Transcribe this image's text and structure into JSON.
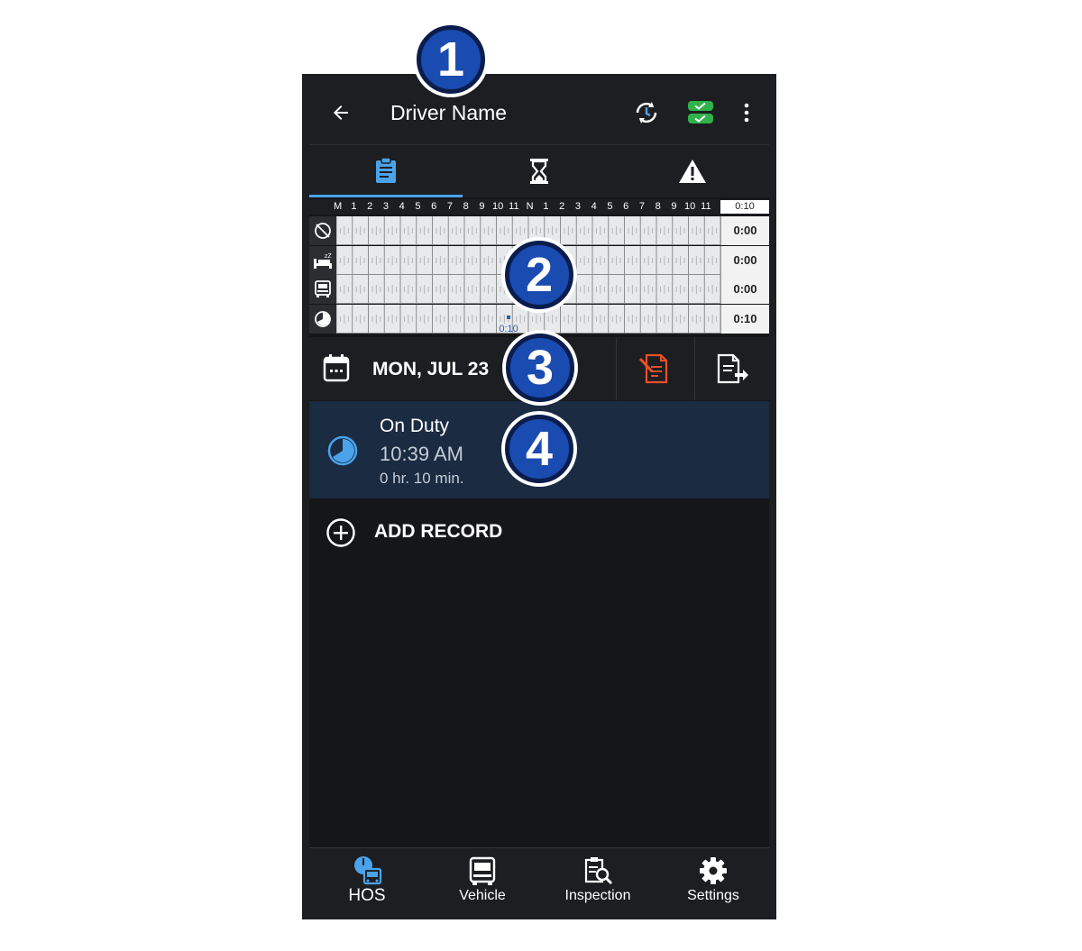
{
  "header": {
    "title": "Driver Name"
  },
  "grid": {
    "hours": [
      "M",
      "1",
      "2",
      "3",
      "4",
      "5",
      "6",
      "7",
      "8",
      "9",
      "10",
      "11",
      "N",
      "1",
      "2",
      "3",
      "4",
      "5",
      "6",
      "7",
      "8",
      "9",
      "10",
      "11"
    ],
    "total_header": "0:10",
    "rows": [
      {
        "status": "off-duty",
        "icon": "off-duty-icon",
        "total": "0:00"
      },
      {
        "status": "sleeper-berth",
        "icon": "sleeper-berth-icon",
        "total": "0:00"
      },
      {
        "status": "driving",
        "icon": "driving-truck-icon",
        "total": "0:00"
      },
      {
        "status": "on-duty",
        "icon": "on-duty-clock-icon",
        "total": "0:10"
      }
    ],
    "segment_label": "0:10"
  },
  "datebar": {
    "date": "MON, JUL 23"
  },
  "record": {
    "status": "On Duty",
    "time": "10:39 AM",
    "duration": "0 hr. 10 min."
  },
  "add_record": {
    "label": "ADD RECORD"
  },
  "nav": [
    {
      "label": "HOS",
      "icon": "hos-icon",
      "active": true
    },
    {
      "label": "Vehicle",
      "icon": "vehicle-icon"
    },
    {
      "label": "Inspection",
      "icon": "inspection-icon"
    },
    {
      "label": "Settings",
      "icon": "settings-gear-icon"
    }
  ],
  "callouts": [
    "1",
    "2",
    "3",
    "4"
  ],
  "colors": {
    "accent": "#4aa3ea",
    "sync_green": "#2fb34a",
    "alert_orange": "#e8502a",
    "record_bg": "#1a2b42",
    "callout_blue": "#1a4bb0"
  }
}
